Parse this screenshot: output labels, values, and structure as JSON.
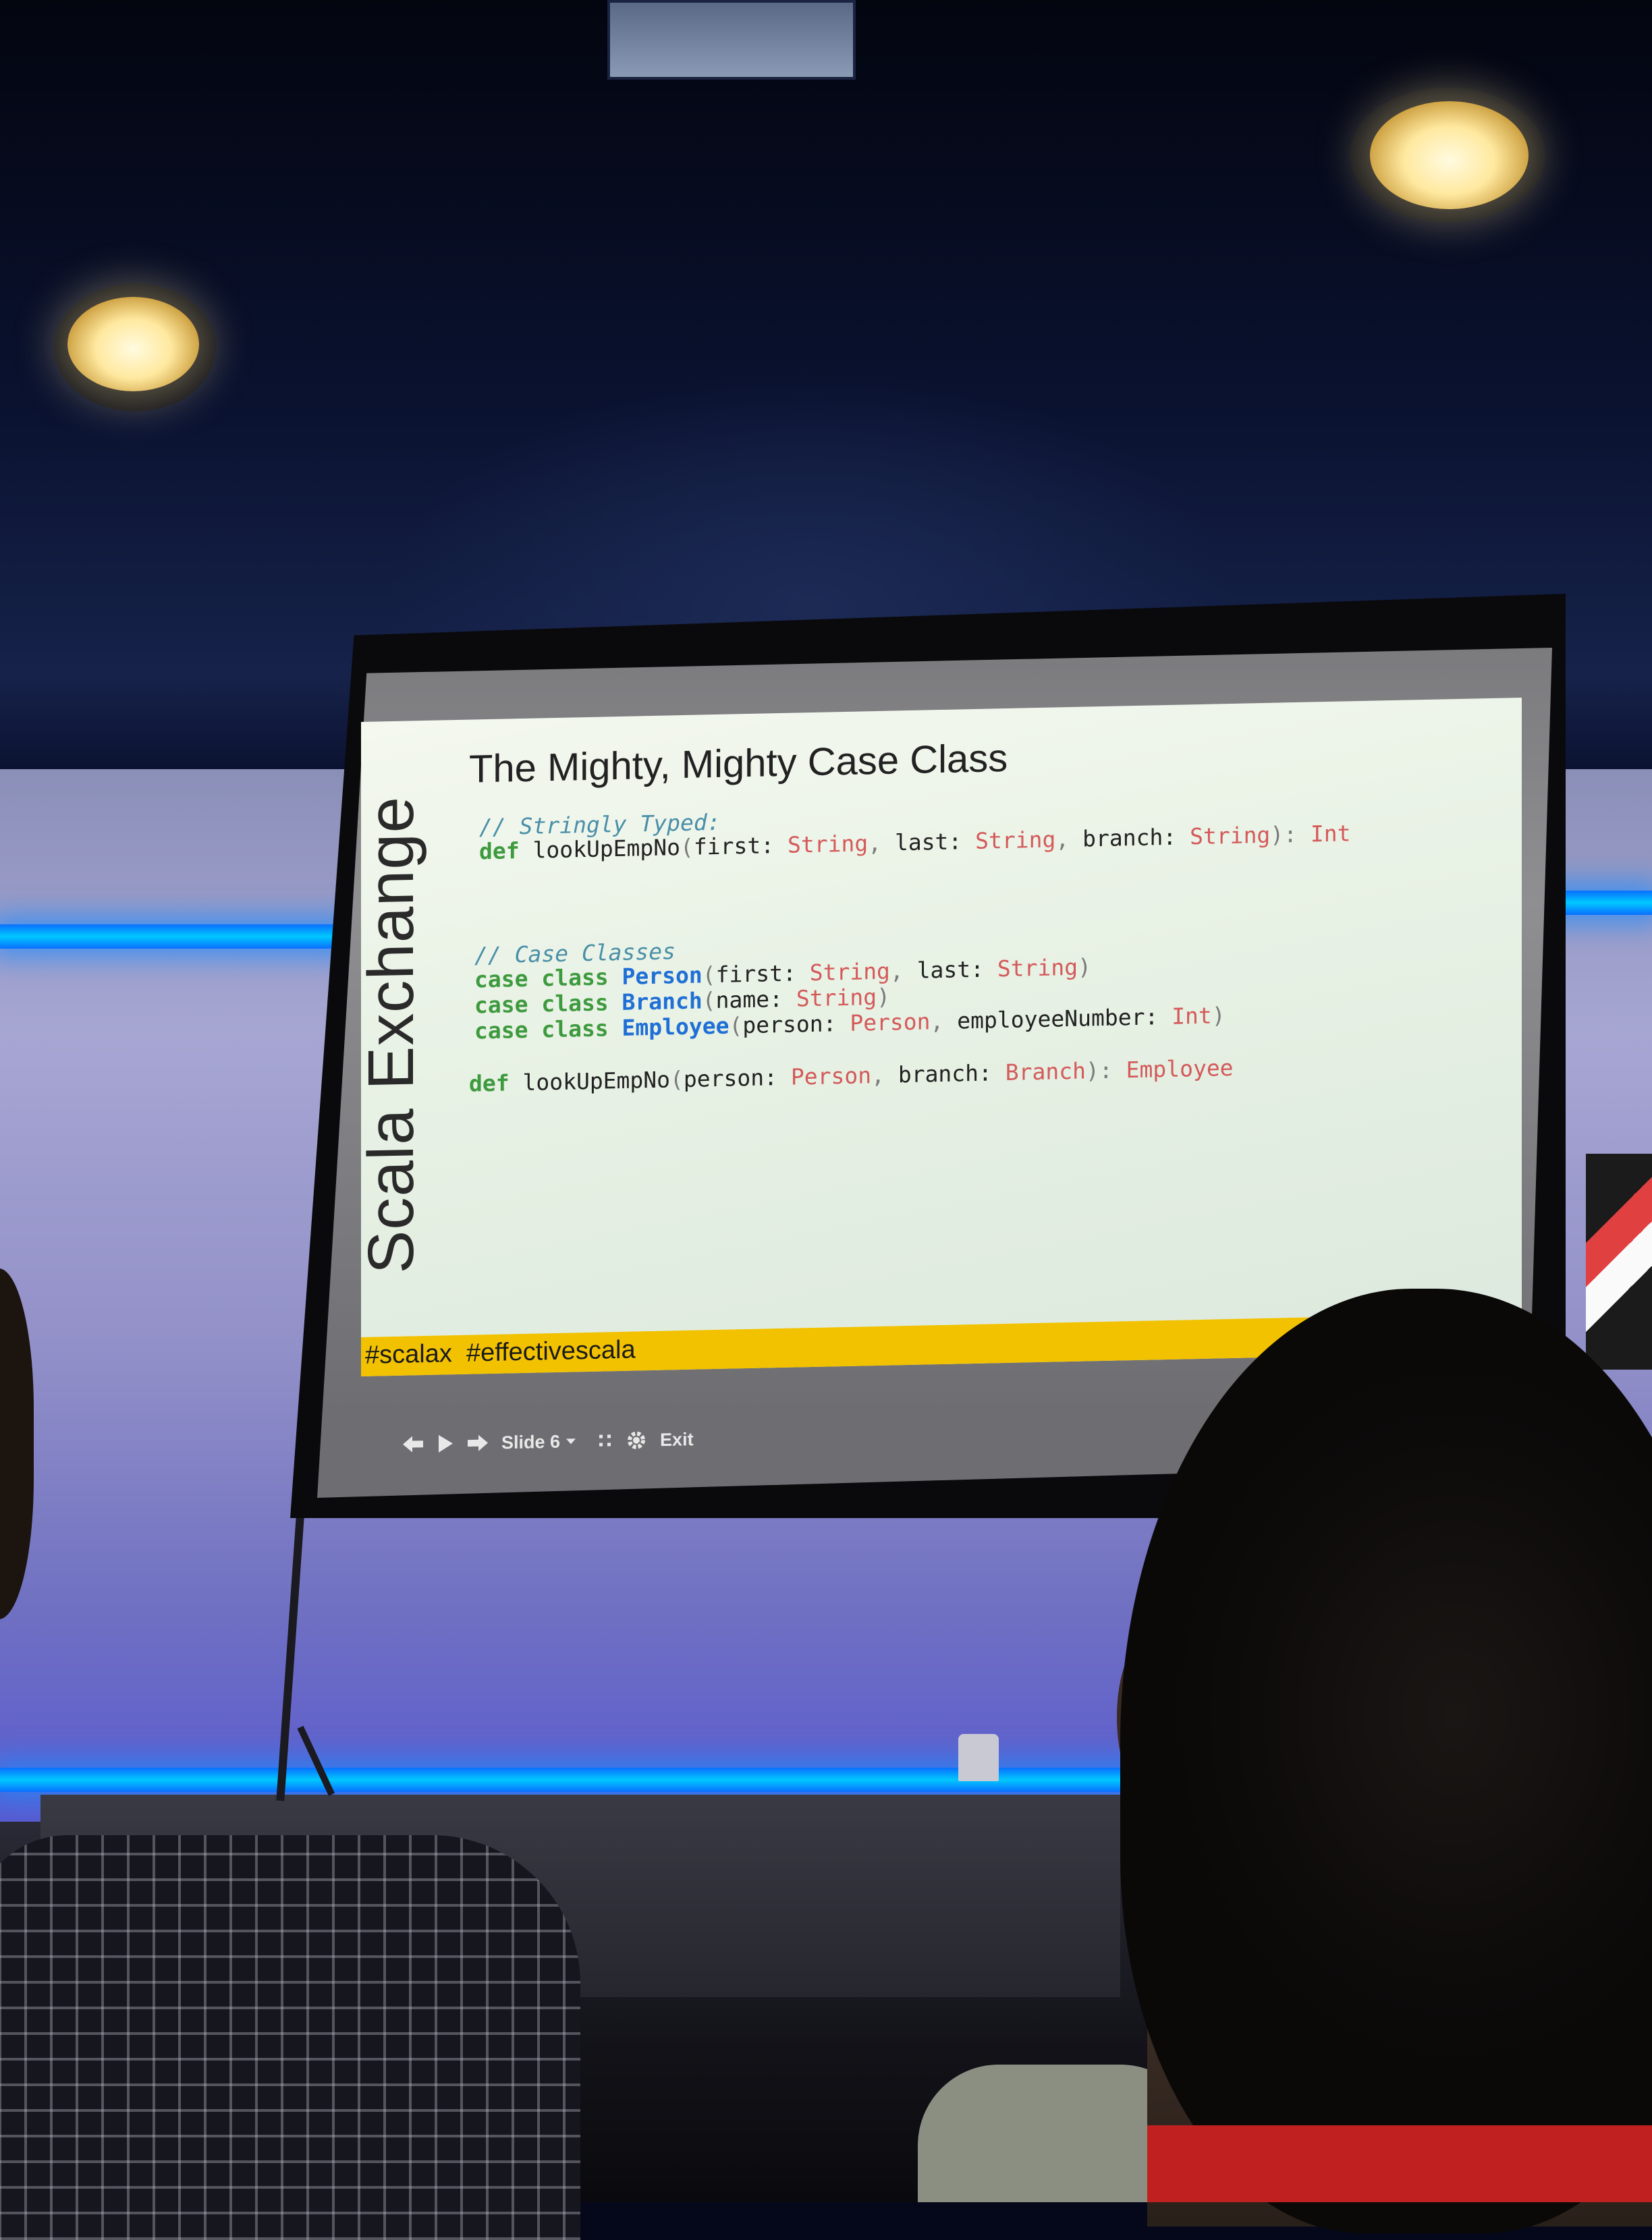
{
  "slide": {
    "side_label": "Scala Exchange",
    "title": "The Mighty, Mighty Case Class",
    "code_lines": [
      [
        {
          "t": "// Stringly Typed:",
          "c": "comment"
        }
      ],
      [
        {
          "t": "def",
          "c": "kw"
        },
        {
          "t": " lookUpEmpNo",
          "c": "id"
        },
        {
          "t": "(",
          "c": "punc"
        },
        {
          "t": "first: ",
          "c": "id"
        },
        {
          "t": "String",
          "c": "type"
        },
        {
          "t": ", ",
          "c": "punc"
        },
        {
          "t": "last: ",
          "c": "id"
        },
        {
          "t": "String",
          "c": "type"
        },
        {
          "t": ", ",
          "c": "punc"
        },
        {
          "t": "branch: ",
          "c": "id"
        },
        {
          "t": "String",
          "c": "type"
        },
        {
          "t": "): ",
          "c": "punc"
        },
        {
          "t": "Int",
          "c": "type"
        }
      ],
      [],
      [],
      [
        {
          "t": "// Case Classes",
          "c": "comment"
        }
      ],
      [
        {
          "t": "case class ",
          "c": "kw"
        },
        {
          "t": "Person",
          "c": "class"
        },
        {
          "t": "(",
          "c": "punc"
        },
        {
          "t": "first: ",
          "c": "id"
        },
        {
          "t": "String",
          "c": "type"
        },
        {
          "t": ", ",
          "c": "punc"
        },
        {
          "t": "last: ",
          "c": "id"
        },
        {
          "t": "String",
          "c": "type"
        },
        {
          "t": ")",
          "c": "punc"
        }
      ],
      [
        {
          "t": "case class ",
          "c": "kw"
        },
        {
          "t": "Branch",
          "c": "class"
        },
        {
          "t": "(",
          "c": "punc"
        },
        {
          "t": "name: ",
          "c": "id"
        },
        {
          "t": "String",
          "c": "type"
        },
        {
          "t": ")",
          "c": "punc"
        }
      ],
      [
        {
          "t": "case class ",
          "c": "kw"
        },
        {
          "t": "Employee",
          "c": "class"
        },
        {
          "t": "(",
          "c": "punc"
        },
        {
          "t": "person: ",
          "c": "id"
        },
        {
          "t": "Person",
          "c": "type"
        },
        {
          "t": ", ",
          "c": "punc"
        },
        {
          "t": "employeeNumber: ",
          "c": "id"
        },
        {
          "t": "Int",
          "c": "type"
        },
        {
          "t": ")",
          "c": "punc"
        }
      ],
      [],
      [
        {
          "t": "def",
          "c": "kw"
        },
        {
          "t": " lookUpEmpNo",
          "c": "id"
        },
        {
          "t": "(",
          "c": "punc"
        },
        {
          "t": "person: ",
          "c": "id"
        },
        {
          "t": "Person",
          "c": "type"
        },
        {
          "t": ", ",
          "c": "punc"
        },
        {
          "t": "branch: ",
          "c": "id"
        },
        {
          "t": "Branch",
          "c": "type"
        },
        {
          "t": "): ",
          "c": "punc"
        },
        {
          "t": "Employee",
          "c": "type"
        }
      ]
    ],
    "hashtags": "#scalax  #effectivescala"
  },
  "controls": {
    "slide_label": "Slide 6",
    "exit_label": "Exit",
    "icons": [
      "back-arrow-icon",
      "play-icon",
      "forward-arrow-icon",
      "chevron-down-icon",
      "grid-icon",
      "gear-icon"
    ]
  },
  "colors": {
    "slide_bg": "#eef5ea",
    "hashtag_bar": "#f2c200",
    "neon": "#00b4ff",
    "keyword": "#3e9a3e",
    "type": "#d45a5a",
    "class_name": "#1f6fd6",
    "comment": "#4a8fa8"
  }
}
